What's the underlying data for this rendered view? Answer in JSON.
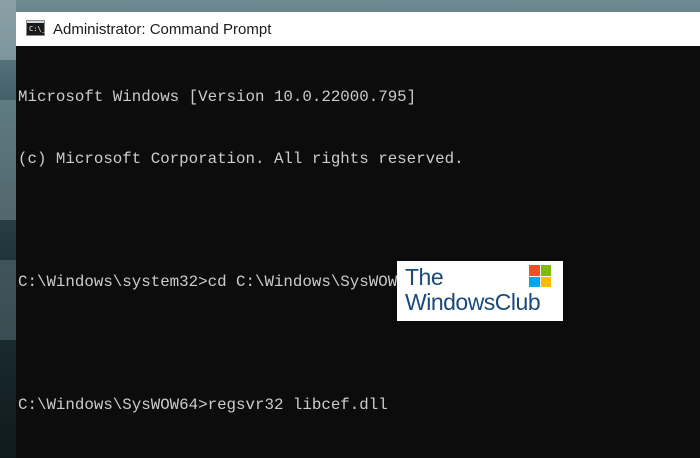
{
  "window": {
    "title": "Administrator: Command Prompt",
    "icon_text": "C:\\_"
  },
  "console": {
    "lines": [
      "Microsoft Windows [Version 10.0.22000.795]",
      "(c) Microsoft Corporation. All rights reserved.",
      "",
      "C:\\Windows\\system32>cd C:\\Windows\\SysWOW64",
      "",
      "C:\\Windows\\SysWOW64>regsvr32 libcef.dll"
    ]
  },
  "watermark": {
    "line1": "The",
    "line2": "WindowsClub",
    "logo_colors": [
      "#f25022",
      "#7fba00",
      "#00a4ef",
      "#ffb900"
    ]
  },
  "colors": {
    "console_bg": "#0c0c0c",
    "console_text": "#cccccc",
    "titlebar_bg": "#ffffff"
  }
}
